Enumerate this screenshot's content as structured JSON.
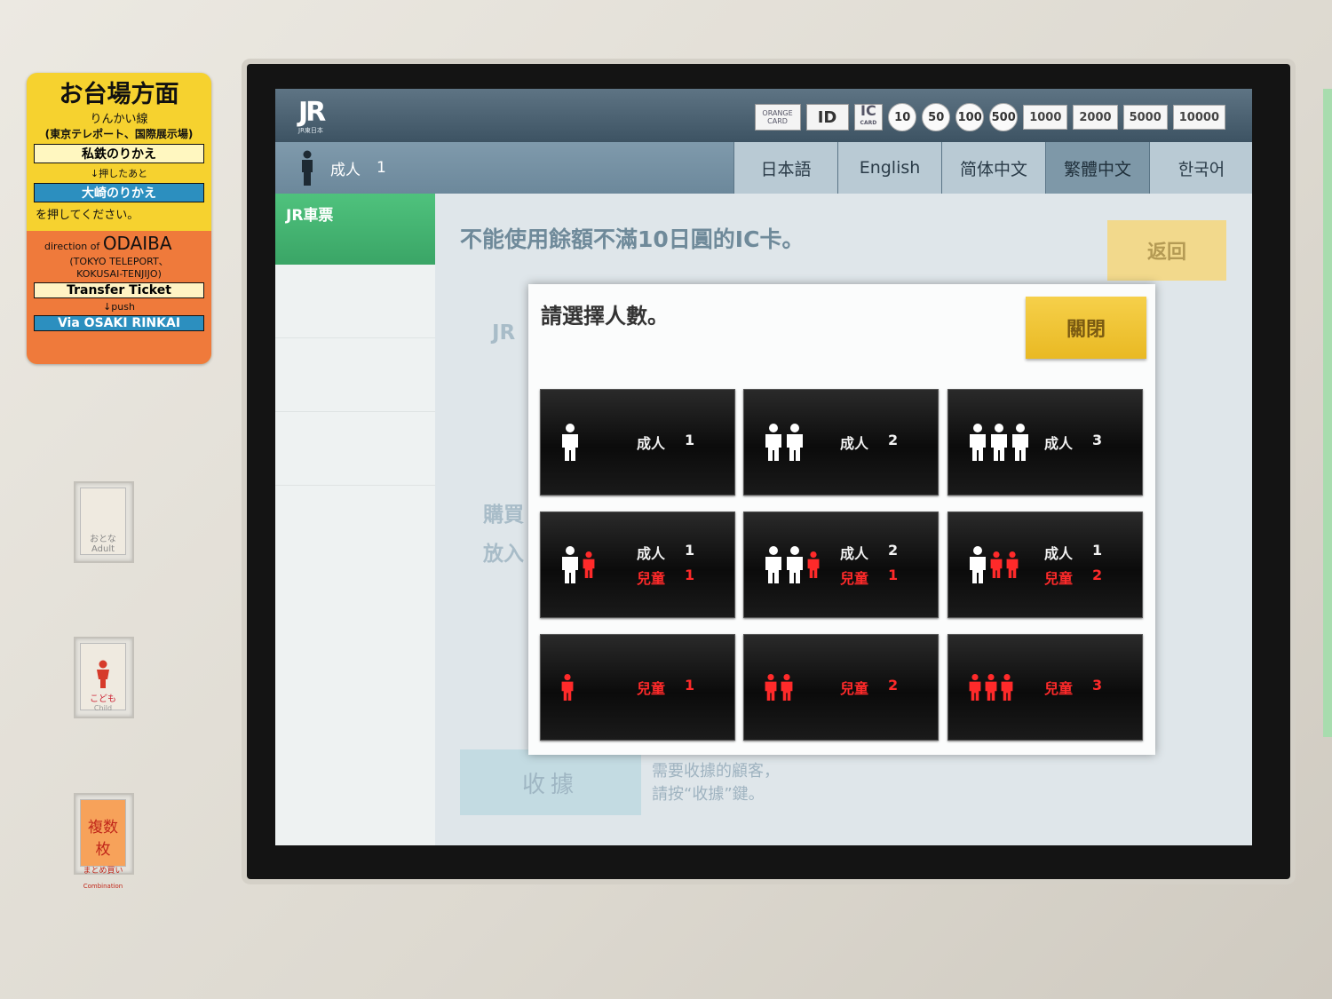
{
  "sticker": {
    "title": "お台場方面",
    "line": "りんかい線",
    "stations": "(東京テレポート、国際展示場)",
    "private_transfer": "私鉄のりかえ",
    "push_after": "↓押したあと",
    "osaki_transfer": "大崎のりかえ",
    "please_press": "を押してください。",
    "direction_of": "direction of",
    "odaiba": "ODAIBA",
    "en_stations_1": "(TOKYO TELEPORT、",
    "en_stations_2": "KOKUSAI-TENJIJO)",
    "transfer_ticket": "Transfer Ticket",
    "push": "↓push",
    "via": "Via OSAKI RINKAI"
  },
  "physical_buttons": {
    "adult": "おとな Adult",
    "child_jp": "こども",
    "child_en": "Child",
    "combo_jp": "複数枚",
    "combo_sub": "まとめ買い",
    "combo_en": "Combination"
  },
  "header": {
    "logo": "JR",
    "logo_sub": "JR東日本",
    "orange_card": "ORANGE CARD",
    "ic_card": "IC",
    "ic_card_sub": "CARD",
    "coins": [
      "10",
      "50",
      "100",
      "500"
    ],
    "bills": [
      "1000",
      "2000",
      "5000",
      "10000"
    ]
  },
  "status": {
    "passenger_label": "成人",
    "passenger_count": "1"
  },
  "languages": [
    {
      "label": "日本語",
      "active": false
    },
    {
      "label": "English",
      "active": false
    },
    {
      "label": "简体中文",
      "active": false
    },
    {
      "label": "繁體中文",
      "active": true
    },
    {
      "label": "한국어",
      "active": false
    }
  ],
  "sidebar": {
    "active_label": "JR車票"
  },
  "main": {
    "message": "不能使用餘額不滿10日圓的IC卡。",
    "back_label": "返回",
    "jr_label": "JR",
    "purchase_label": "購買",
    "insert_label": "放入",
    "receipt_label": "收據",
    "receipt_note_1": "需要收據的顧客，",
    "receipt_note_2": "請按“收據”鍵。"
  },
  "dialog": {
    "title": "請選擇人數。",
    "close_label": "關閉",
    "options": [
      {
        "adults": 1,
        "children": 0,
        "adult_label": "成人",
        "child_label": "",
        "adult_count": "1",
        "child_count": ""
      },
      {
        "adults": 2,
        "children": 0,
        "adult_label": "成人",
        "child_label": "",
        "adult_count": "2",
        "child_count": ""
      },
      {
        "adults": 3,
        "children": 0,
        "adult_label": "成人",
        "child_label": "",
        "adult_count": "3",
        "child_count": ""
      },
      {
        "adults": 1,
        "children": 1,
        "adult_label": "成人",
        "child_label": "兒童",
        "adult_count": "1",
        "child_count": "1"
      },
      {
        "adults": 2,
        "children": 1,
        "adult_label": "成人",
        "child_label": "兒童",
        "adult_count": "2",
        "child_count": "1"
      },
      {
        "adults": 1,
        "children": 2,
        "adult_label": "成人",
        "child_label": "兒童",
        "adult_count": "1",
        "child_count": "2"
      },
      {
        "adults": 0,
        "children": 1,
        "adult_label": "",
        "child_label": "兒童",
        "adult_count": "",
        "child_count": "1"
      },
      {
        "adults": 0,
        "children": 2,
        "adult_label": "",
        "child_label": "兒童",
        "adult_count": "",
        "child_count": "2"
      },
      {
        "adults": 0,
        "children": 3,
        "adult_label": "",
        "child_label": "兒童",
        "adult_count": "",
        "child_count": "3"
      }
    ]
  },
  "colors": {
    "adult_figure": "#ffffff",
    "child_figure": "#ff2a2a",
    "close_button": "#f2c73a",
    "active_tab": "#4fc27d"
  }
}
